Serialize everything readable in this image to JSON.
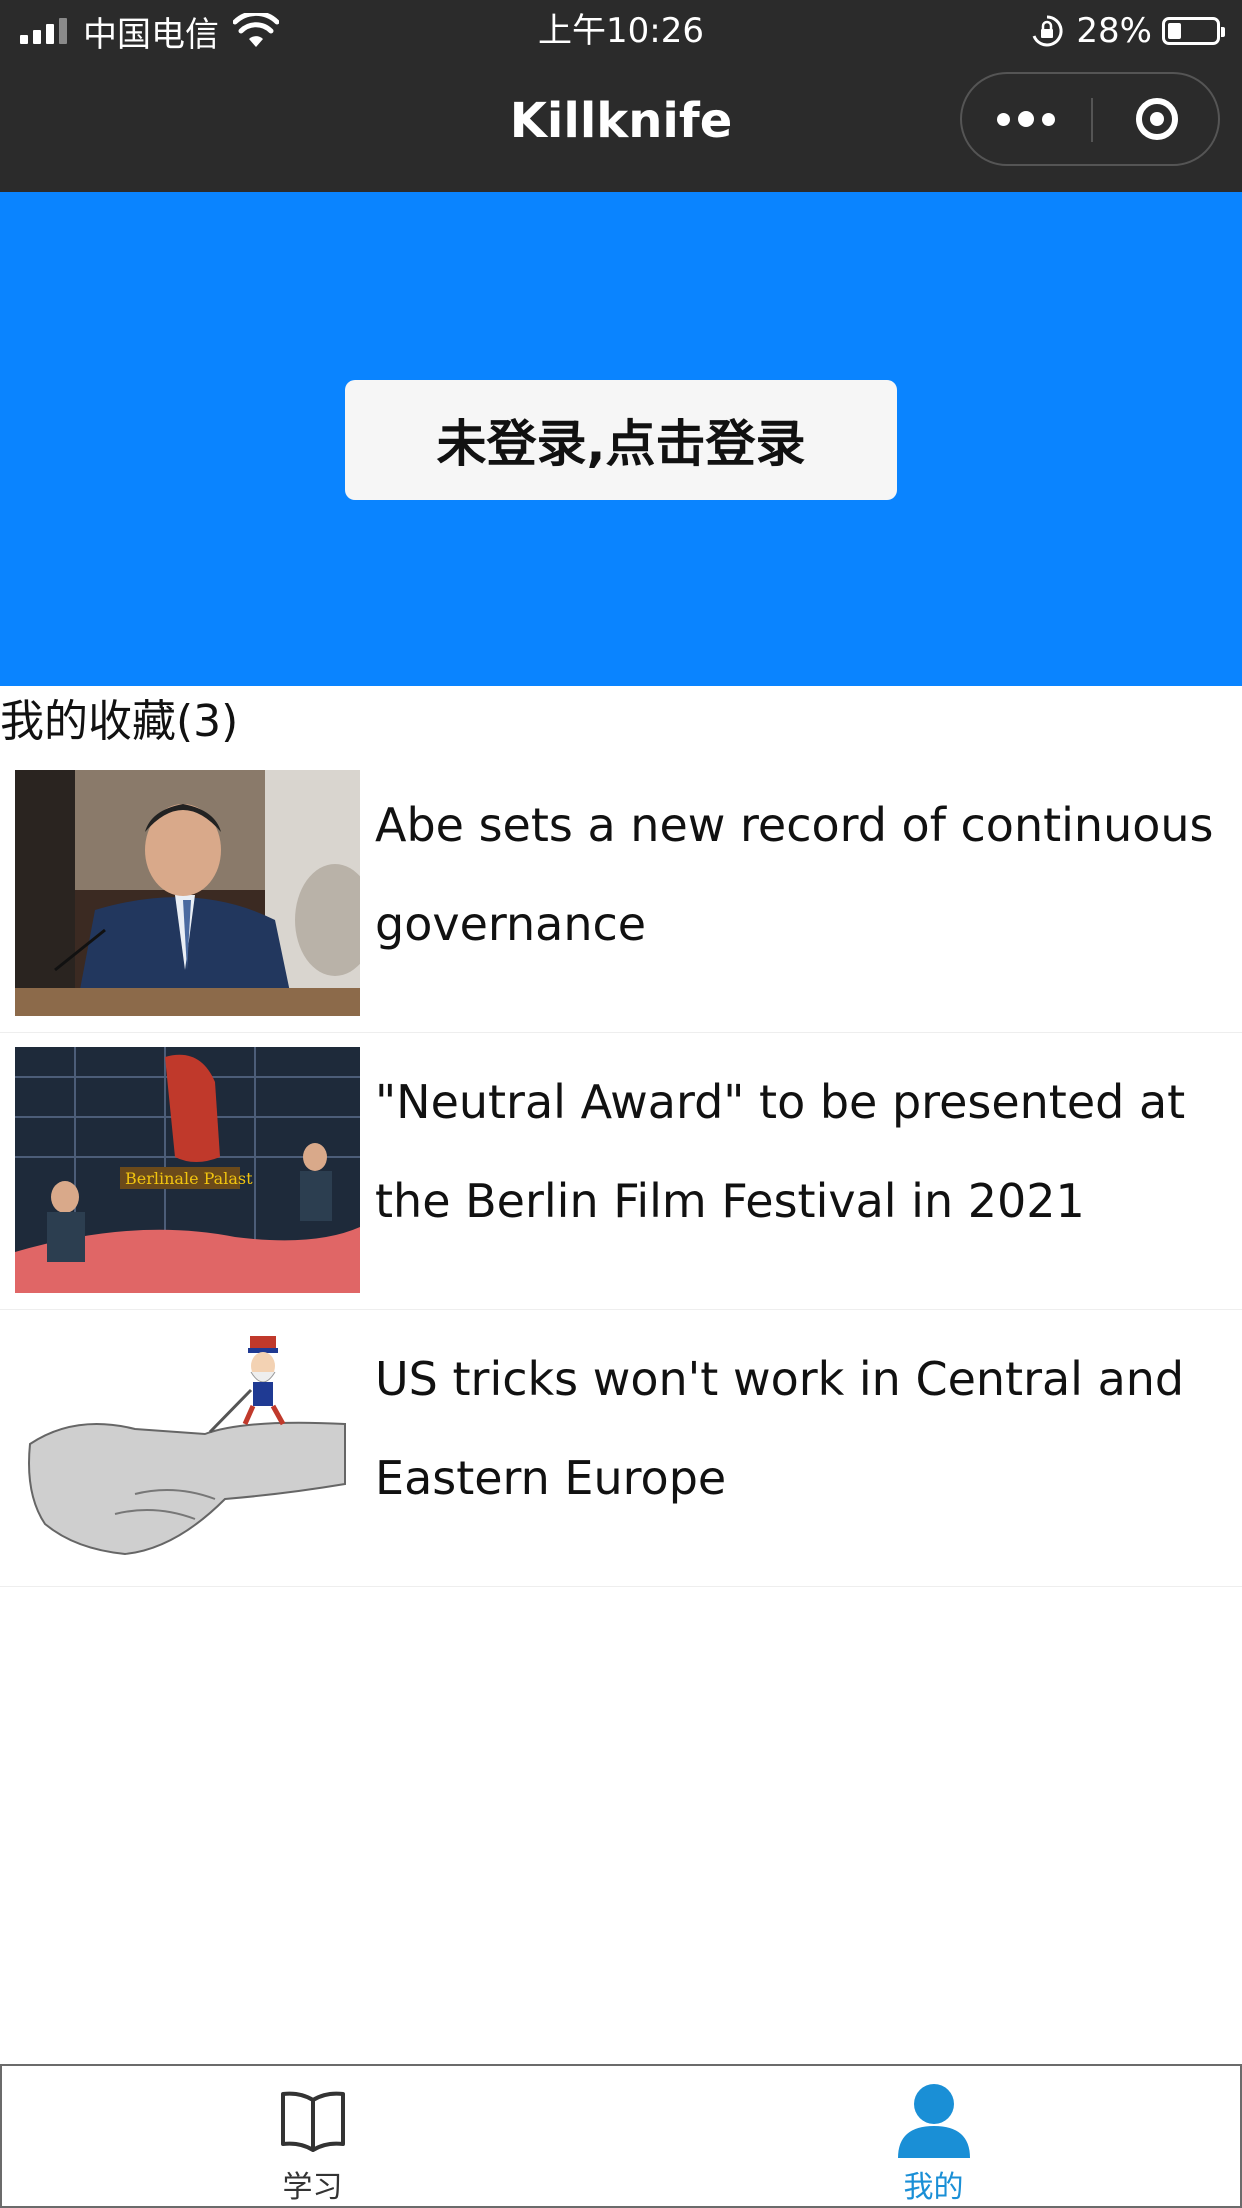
{
  "status_bar": {
    "carrier": "中国电信",
    "time": "上午10:26",
    "battery_percent": "28%",
    "battery_level": 0.28
  },
  "nav": {
    "title": "Killknife",
    "more_icon": "more-dots-icon",
    "close_icon": "target-close-icon"
  },
  "banner": {
    "color": "#0a84ff",
    "login_label": "未登录,点击登录"
  },
  "favorites": {
    "title": "我的收藏(3)",
    "items": [
      {
        "title": "Abe sets a new record of continuous governance",
        "thumb": "press-conference-photo"
      },
      {
        "title": "\"Neutral Award\" to be presented at the Berlin Film Festival in 2021",
        "thumb": "berlinale-palast-photo"
      },
      {
        "title": "US tricks won't work in Central and Eastern Europe",
        "thumb": "handshake-cartoon"
      }
    ]
  },
  "tabbar": {
    "tabs": [
      {
        "label": "学习",
        "icon": "book-icon",
        "active": false
      },
      {
        "label": "我的",
        "icon": "user-icon",
        "active": true
      }
    ],
    "active_color": "#1a8fd6"
  }
}
